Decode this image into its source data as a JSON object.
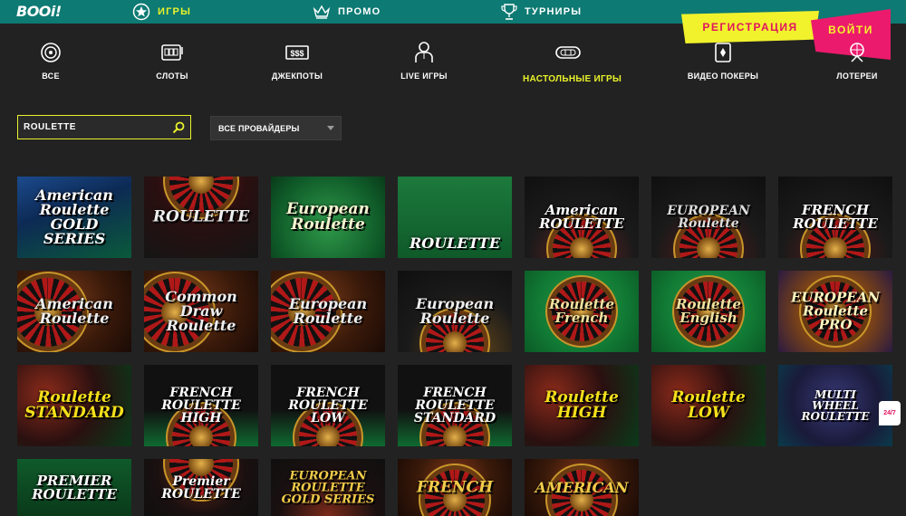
{
  "brand": {
    "logo": "BOOi!"
  },
  "topnav": [
    {
      "label": "ИГРЫ",
      "icon": "star-badge-icon",
      "active": true
    },
    {
      "label": "ПРОМО",
      "icon": "crown-icon",
      "active": false
    },
    {
      "label": "ТУРНИРЫ",
      "icon": "trophy-icon",
      "active": false
    }
  ],
  "auth": {
    "register": "РЕГИСТРАЦИЯ",
    "login": "ВОЙТИ"
  },
  "categories": [
    {
      "label": "ВСЕ",
      "icon": "all-games-icon"
    },
    {
      "label": "СЛОТЫ",
      "icon": "slot-machine-icon"
    },
    {
      "label": "ДЖЕКПОТЫ",
      "icon": "jackpot-icon"
    },
    {
      "label": "LIVE ИГРЫ",
      "icon": "live-dealer-icon"
    },
    {
      "label": "НАСТОЛЬНЫЕ ИГРЫ",
      "icon": "table-games-icon",
      "active": true
    },
    {
      "label": "ВИДЕО ПОКЕРЫ",
      "icon": "video-poker-icon"
    },
    {
      "label": "ЛОТЕРЕИ",
      "icon": "lottery-icon"
    }
  ],
  "search": {
    "value": "ROULETTE",
    "placeholder": ""
  },
  "provider_select": {
    "value": "ВСЕ ПРОВАЙДЕРЫ"
  },
  "games": [
    {
      "title": "American\nRoulette\nGOLD SERIES",
      "style": "american-gold"
    },
    {
      "title": "ROULETTE",
      "style": "dark-wheel"
    },
    {
      "title": "European\nRoulette",
      "style": "green-felt"
    },
    {
      "title": "ROULETTE",
      "style": "green-table"
    },
    {
      "title": "American\nROULETTE",
      "style": "am-flag"
    },
    {
      "title": "EUROPEAN\nRoulette",
      "style": "dark-wheel2"
    },
    {
      "title": "FRENCH\nROULETTE",
      "style": "french-dark"
    },
    {
      "title": "American\nRoulette",
      "style": "wood-wheel"
    },
    {
      "title": "Common Draw\nRoulette",
      "style": "wood-wheel"
    },
    {
      "title": "European\nRoulette",
      "style": "wood-wheel"
    },
    {
      "title": "European\nRoulette",
      "style": "dark-wheel3"
    },
    {
      "title": "Roulette\nFrench",
      "style": "green-label"
    },
    {
      "title": "Roulette\nEnglish",
      "style": "green-label"
    },
    {
      "title": "EUROPEAN\nRoulette\nPRO",
      "style": "gold-pro"
    },
    {
      "title": "Roulette\nSTANDARD",
      "style": "yellow-roulette"
    },
    {
      "title": "FRENCH\nROULETTE\nHIGH",
      "style": "french-table"
    },
    {
      "title": "FRENCH\nROULETTE\nLOW",
      "style": "french-table"
    },
    {
      "title": "FRENCH\nROULETTE\nSTANDARD",
      "style": "french-table"
    },
    {
      "title": "Roulette\nHIGH",
      "style": "yellow-roulette"
    },
    {
      "title": "Roulette\nLOW",
      "style": "yellow-roulette"
    },
    {
      "title": "MULTI\nWHEEL\nROULETTE",
      "style": "multi-wheel"
    },
    {
      "title": "PREMIER\nROULETTE",
      "style": "premier"
    },
    {
      "title": "Premier\nROULETTE",
      "style": "premier2"
    },
    {
      "title": "EUROPEAN\nROULETTE GOLD SERIES",
      "style": "euro-gold"
    },
    {
      "title": "FRENCH",
      "style": "french-wheel"
    },
    {
      "title": "AMERICAN",
      "style": "american-wheel"
    }
  ],
  "support_badge": "24/7",
  "colors": {
    "teal": "#0d7a73",
    "yellow": "#e9f22a",
    "pink": "#ec1a6d",
    "bg": "#222222"
  }
}
